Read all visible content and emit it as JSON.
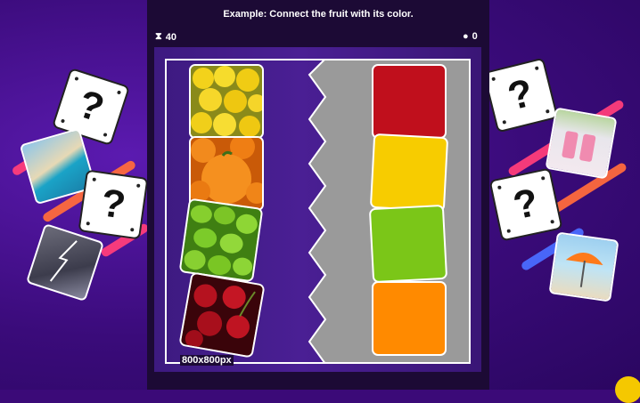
{
  "instruction": "Example: Connect the fruit with its color.",
  "hud": {
    "timer_icon": "hourglass-icon",
    "timer_value": "40",
    "score_icon": "turtle-icon",
    "score_value": "0"
  },
  "board": {
    "size_label": "800x800px",
    "fruits": [
      {
        "name": "lemons"
      },
      {
        "name": "oranges"
      },
      {
        "name": "green pears"
      },
      {
        "name": "cherries"
      }
    ],
    "colors": [
      {
        "name": "red",
        "hex": "#c00f1c"
      },
      {
        "name": "yellow",
        "hex": "#f7cc00"
      },
      {
        "name": "green",
        "hex": "#7bc618"
      },
      {
        "name": "orange",
        "hex": "#ff8a00"
      }
    ]
  },
  "side_cards": {
    "question_mark": "?"
  },
  "palette": {
    "background": "#3b0a78",
    "panel": "#1c0a35",
    "divider_gray": "#9a9a9a"
  }
}
